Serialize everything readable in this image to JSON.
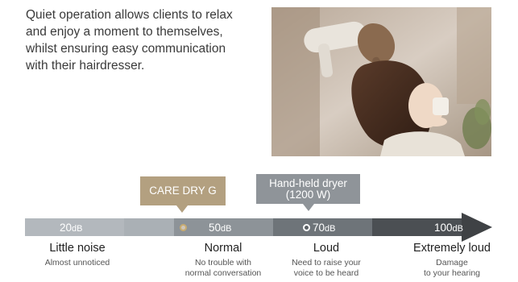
{
  "intro": {
    "lines": [
      "Quiet operation allows clients to relax",
      "and enjoy a moment to themselves,",
      "whilst ensuring easy communication",
      "with their hairdresser."
    ]
  },
  "photo": {
    "alt": "Client relaxing with a drink while hair is dried"
  },
  "scale": {
    "levels": [
      {
        "value": "20",
        "unit": "dB"
      },
      {
        "value": "50",
        "unit": "dB"
      },
      {
        "value": "70",
        "unit": "dB"
      },
      {
        "value": "100",
        "unit": "dB"
      }
    ],
    "colors": {
      "seg1": "#b3b8bd",
      "seg2": "#9aa0a5",
      "seg3": "#7c8287",
      "seg4": "#5d6267",
      "seg5": "#3f4245"
    }
  },
  "markers": {
    "care_dry": {
      "label": "CARE DRY G",
      "color": "#b3a080"
    },
    "hand_held": {
      "label_line1": "Hand-held dryer",
      "label_line2": "(1200 W)",
      "color": "#8f9499"
    }
  },
  "categories": [
    {
      "title": "Little noise",
      "desc_line1": "Almost unnoticed",
      "desc_line2": ""
    },
    {
      "title": "Normal",
      "desc_line1": "No trouble with",
      "desc_line2": "normal conversation"
    },
    {
      "title": "Loud",
      "desc_line1": "Need to raise your",
      "desc_line2": "voice to be heard"
    },
    {
      "title": "Extremely loud",
      "desc_line1": "Damage",
      "desc_line2": "to your hearing"
    }
  ]
}
